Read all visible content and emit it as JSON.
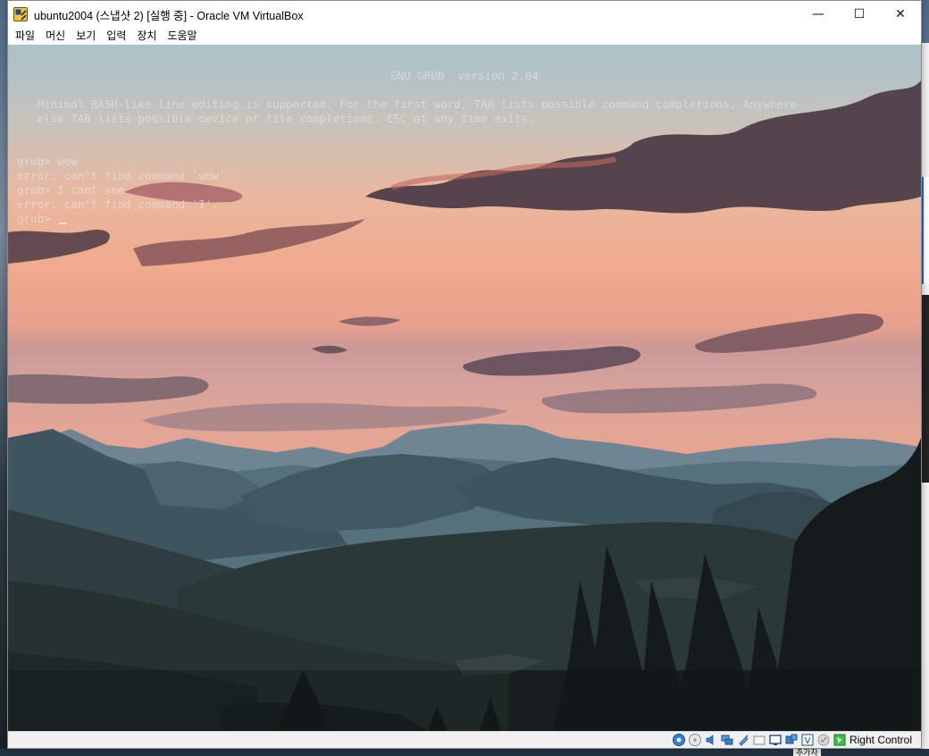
{
  "window": {
    "title": "ubuntu2004 (스냅샷 2) [실행 중] - Oracle VM VirtualBox",
    "minimize_glyph": "—",
    "maximize_glyph": "☐",
    "close_glyph": "✕"
  },
  "menu": [
    "파일",
    "머신",
    "보기",
    "입력",
    "장치",
    "도움말"
  ],
  "console": {
    "header": "GNU GRUB  version 2.04",
    "intro_line_1": "   Minimal BASH-like line editing is supported. For the first word, TAB lists possible command completions. Anywhere",
    "intro_line_2": "   else TAB lists possible device or file completions. ESC at any time exits.",
    "lines": [
      "grub> wow",
      "error: can't find command `wow'.",
      "grub> I cant see",
      "error: can't find command `I'.",
      "grub> "
    ]
  },
  "statusbar": {
    "icons": [
      "hard-disk-icon",
      "optical-drive-icon",
      "audio-icon",
      "network-icon",
      "usb-icon",
      "shared-folders-icon",
      "display-icon",
      "video-capture-icon",
      "recording-icon",
      "cpu-icon",
      "mouse-integration-icon",
      "host-key-icon"
    ],
    "host_key": "Right Control"
  },
  "desktop": {
    "hint": "추가자"
  },
  "colors": {
    "accent": "#1f6fc6",
    "console_text": "#e4e8ee"
  }
}
